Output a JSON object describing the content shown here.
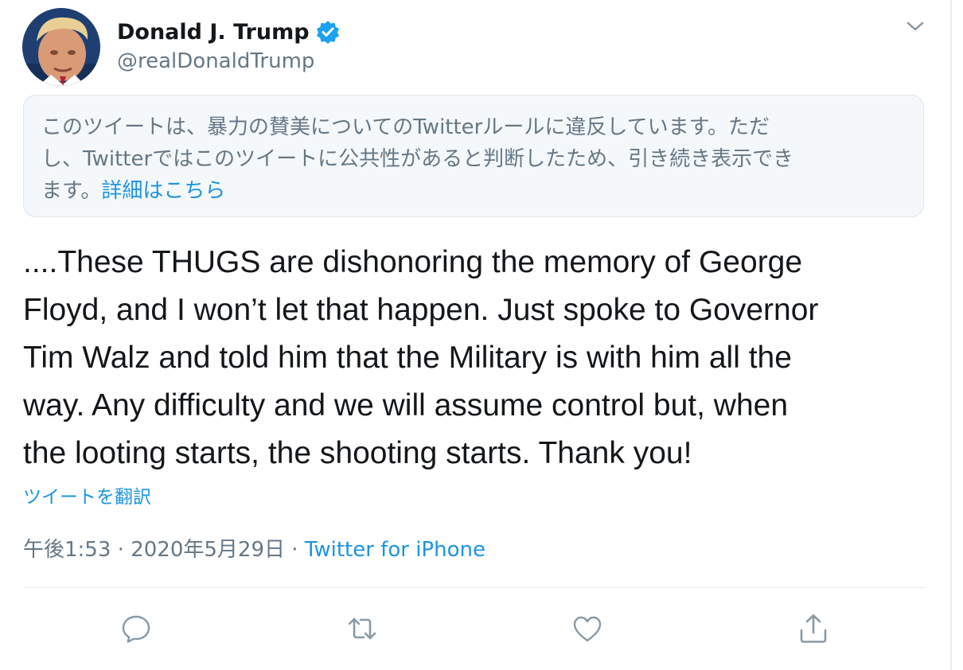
{
  "author": {
    "display_name": "Donald J. Trump",
    "handle": "@realDonaldTrump",
    "verified_icon": "verified-badge-icon"
  },
  "notice": {
    "line1": "このツイートは、暴力の賛美についてのTwitterルールに違反しています。ただ",
    "line2": "し、Twitterではこのツイートに公共性があると判断したため、引き続き表示でき",
    "line3": "ます。",
    "details_link": "詳細はこちら"
  },
  "tweet": {
    "lines": [
      "....These THUGS are dishonoring the memory of George",
      "Floyd, and I won’t let that happen. Just spoke to Governor",
      "Tim Walz and told him that the Military is with him all the",
      "way. Any difficulty and we will assume control but, when",
      "the looting starts, the shooting starts. Thank you!"
    ],
    "translate_label": "ツイートを翻訳"
  },
  "meta": {
    "time": "午後1:53",
    "separator": " · ",
    "date": "2020年5月29日",
    "source": "Twitter for iPhone"
  },
  "actions": {
    "reply_icon": "reply-icon",
    "retweet_icon": "retweet-icon",
    "like_icon": "like-icon",
    "share_icon": "share-icon"
  },
  "colors": {
    "link": "#1b95e0",
    "secondary_text": "#657786",
    "verified": "#1da1f2"
  }
}
